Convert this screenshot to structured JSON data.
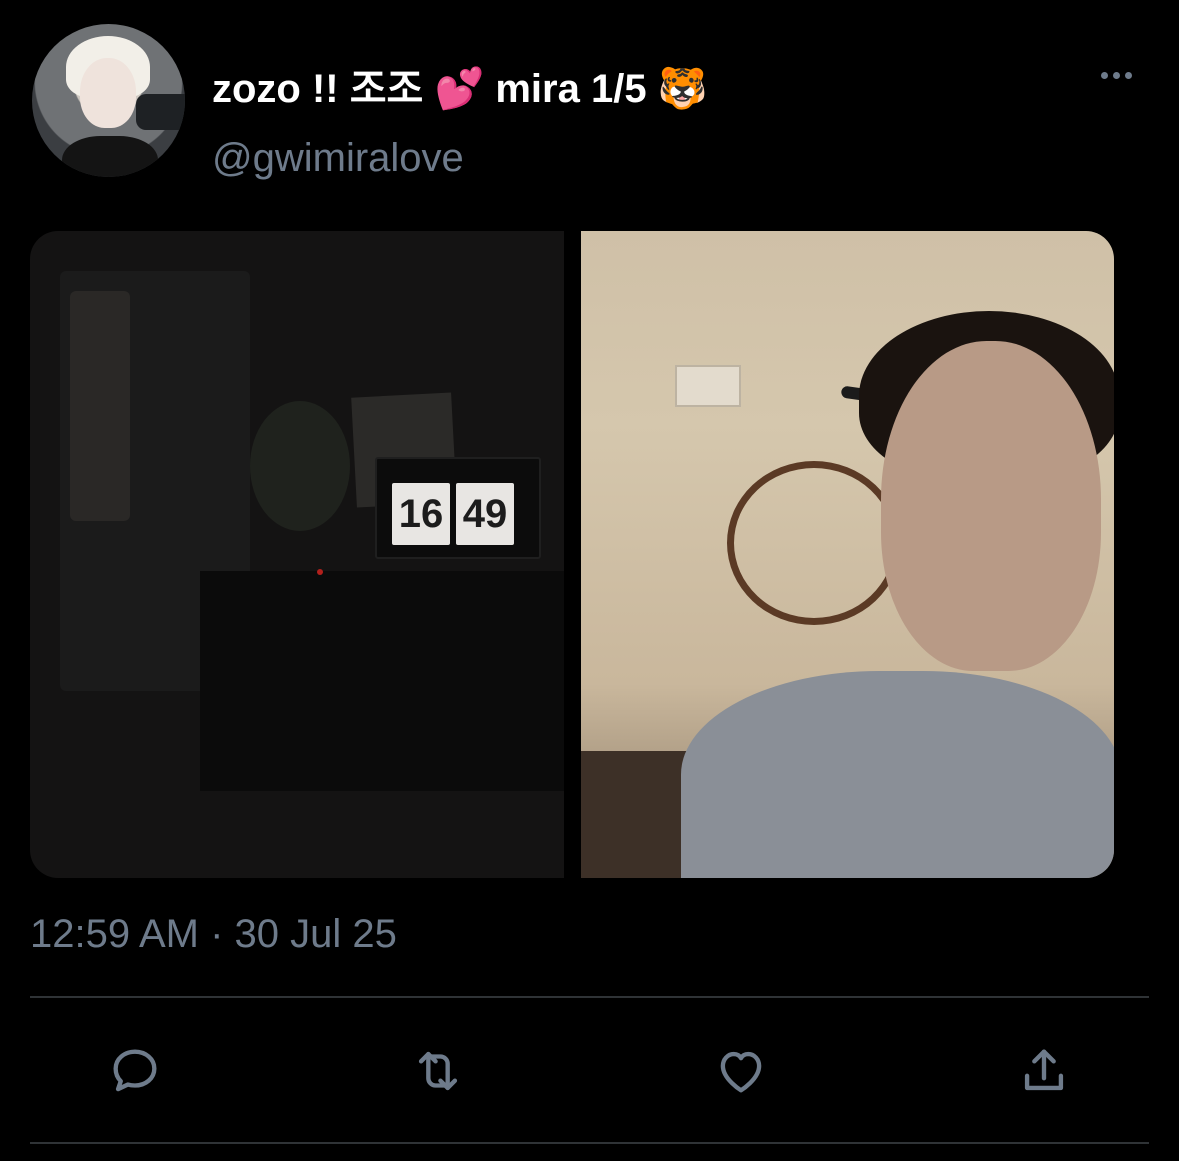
{
  "tweet": {
    "display_name": "zozo !! 조조 💕 mira 1/5 🐯",
    "handle": "@gwimiralove",
    "timestamp": "12:59 AM · 30 Jul 25"
  },
  "media": {
    "left_photo": {
      "clock_hours": "16",
      "clock_minutes": "49"
    }
  },
  "actions": [
    {
      "icon": "reply-icon"
    },
    {
      "icon": "retweet-icon"
    },
    {
      "icon": "like-icon"
    },
    {
      "icon": "share-icon"
    }
  ],
  "colors": {
    "background": "#000000",
    "secondary_text": "#6e7b8b",
    "divider": "#2f3336"
  }
}
